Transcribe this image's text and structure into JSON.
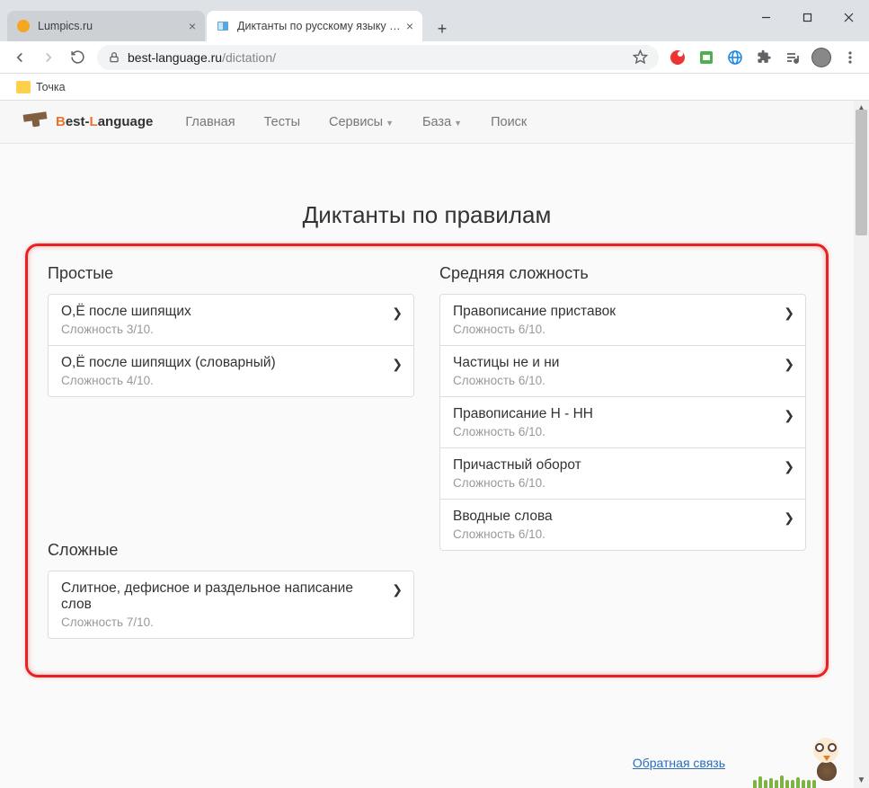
{
  "tabs": [
    {
      "title": "Lumpics.ru"
    },
    {
      "title": "Диктанты по русскому языку - п"
    }
  ],
  "url_host": "best-language.ru",
  "url_path": "/dictation/",
  "bookmarks": {
    "item0": "Точка"
  },
  "nav": {
    "brand_pre": "B",
    "brand_mid": "est-",
    "brand_l": "L",
    "brand_end": "anguage",
    "home": "Главная",
    "tests": "Тесты",
    "services": "Сервисы",
    "base": "База",
    "search": "Поиск"
  },
  "page_title": "Диктанты по правилам",
  "sections": {
    "easy": {
      "heading": "Простые",
      "items": [
        {
          "title": "О,Ё после шипящих",
          "sub": "Сложность 3/10."
        },
        {
          "title": "О,Ё после шипящих (словарный)",
          "sub": "Сложность 4/10."
        }
      ]
    },
    "medium": {
      "heading": "Средняя сложность",
      "items": [
        {
          "title": "Правописание приставок",
          "sub": "Сложность 6/10."
        },
        {
          "title": "Частицы не и ни",
          "sub": "Сложность 6/10."
        },
        {
          "title": "Правописание Н - НН",
          "sub": "Сложность 6/10."
        },
        {
          "title": "Причастный оборот",
          "sub": "Сложность 6/10."
        },
        {
          "title": "Вводные слова",
          "sub": "Сложность 6/10."
        }
      ]
    },
    "hard": {
      "heading": "Сложные",
      "items": [
        {
          "title": "Слитное, дефисное и раздельное написание слов",
          "sub": "Сложность 7/10."
        }
      ]
    }
  },
  "footer_link": "Обратная связь"
}
